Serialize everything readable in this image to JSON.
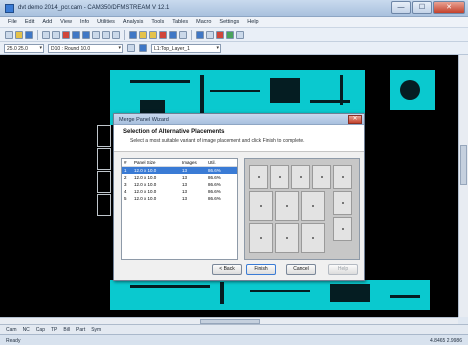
{
  "window": {
    "title": "dvt demo 2014_pcr.cam - CAM350/DFMSTREAM V 12.1",
    "minimize": "—",
    "maximize": "☐",
    "close": "✕"
  },
  "menu": [
    "File",
    "Edit",
    "Add",
    "View",
    "Info",
    "Utilities",
    "Analysis",
    "Tools",
    "Tables",
    "Macro",
    "Settings",
    "Help"
  ],
  "toolbar2": {
    "coord": "25.0 25.0",
    "dcode": "D10 : Round 10.0",
    "layer": "L1:Top_Layer_1"
  },
  "dialog": {
    "title": "Merge Panel Wizard",
    "close": "✕",
    "heading": "Selection of Alternative Placements",
    "subtitle": "Select a most suitable variant of image placement and click Finish to complete.",
    "columns": [
      "#",
      "Panel Size",
      "Images",
      "Util."
    ],
    "rows": [
      {
        "num": "1",
        "size": "12.0 x 10.0",
        "images": "13",
        "util": "86.6%"
      },
      {
        "num": "2",
        "size": "12.0 x 10.0",
        "images": "13",
        "util": "86.6%"
      },
      {
        "num": "3",
        "size": "12.0 x 10.0",
        "images": "13",
        "util": "86.6%"
      },
      {
        "num": "4",
        "size": "12.0 x 10.0",
        "images": "13",
        "util": "86.6%"
      },
      {
        "num": "5",
        "size": "12.0 x 10.0",
        "images": "13",
        "util": "86.6%"
      }
    ],
    "buttons": {
      "back": "< Back",
      "finish": "Finish",
      "cancel": "Cancel",
      "help": "Help"
    }
  },
  "tabs": [
    "Cam",
    "NC",
    "Cap",
    "TP",
    "Bill",
    "Part",
    "Sym"
  ],
  "status": {
    "text": "Ready",
    "coords": "4.8465 2.9986"
  },
  "colors": {
    "pcb": "#0ac9cf",
    "workspace": "#000000",
    "selection": "#3a7bd5"
  }
}
